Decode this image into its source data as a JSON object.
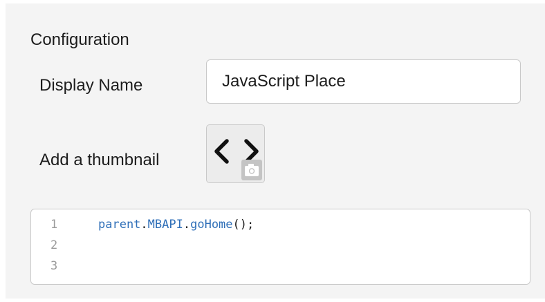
{
  "config": {
    "title": "Configuration",
    "display_name_label": "Display Name",
    "display_name_value": "JavaScript Place",
    "thumbnail_label": "Add a thumbnail",
    "thumbnail_icon": "code-brackets-icon",
    "thumbnail_badge_icon": "camera-icon"
  },
  "editor": {
    "line_numbers": [
      "1",
      "2",
      "3"
    ],
    "line1_tokens": {
      "t1": "parent",
      "t2": ".",
      "t3": "MBAPI",
      "t4": ".",
      "t5": "goHome",
      "t6": "();"
    },
    "line2": "",
    "line3": ""
  },
  "colors": {
    "panel_bg": "#f4f4f4",
    "code_identifier": "#2f6fb8",
    "line_number": "#9a9a9a",
    "border": "#c9c9c9"
  }
}
